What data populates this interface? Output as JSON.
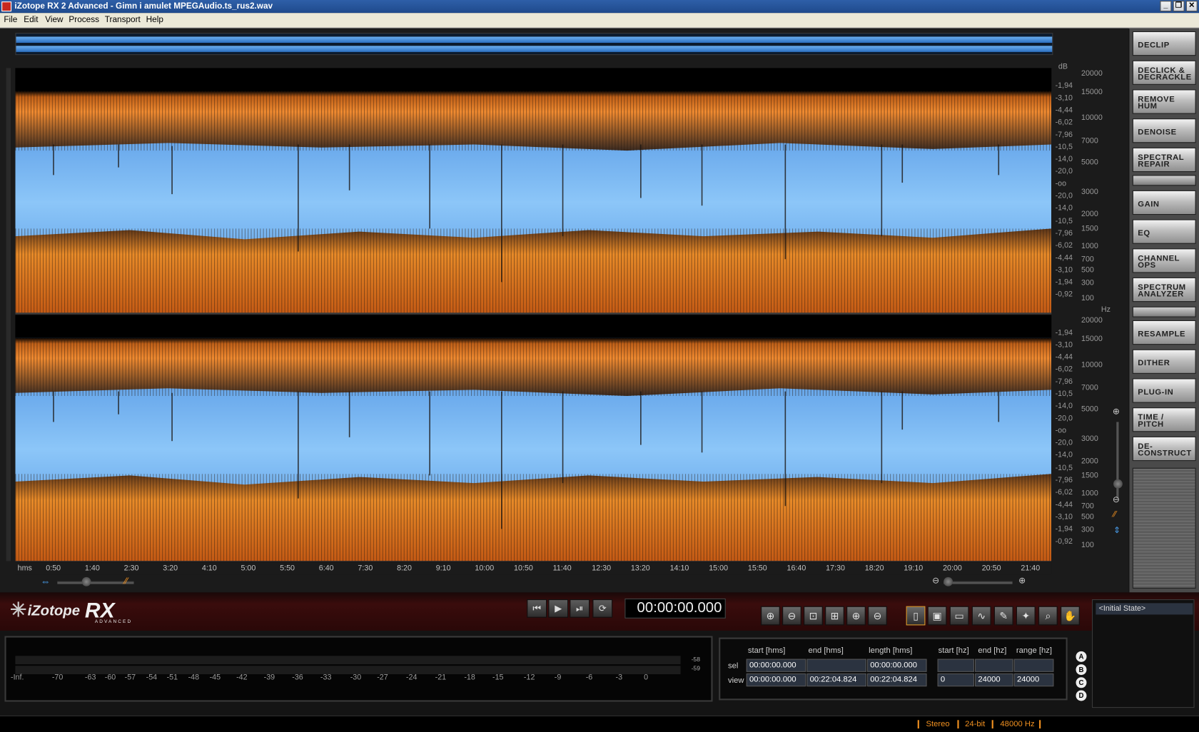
{
  "window": {
    "title": "iZotope RX 2 Advanced - Gimn i amulet MPEGAudio.ts_rus2.wav"
  },
  "menu": [
    "File",
    "Edit",
    "View",
    "Process",
    "Transport",
    "Help"
  ],
  "db_unit": "dB",
  "hz_unit": "Hz",
  "db_labels": [
    "-1,94",
    "-3,10",
    "-4,44",
    "-6,02",
    "-7,96",
    "-10,5",
    "-14,0",
    "-20,0",
    "-oo",
    "-20,0",
    "-14,0",
    "-10,5",
    "-7,96",
    "-6,02",
    "-4,44",
    "-3,10",
    "-1,94",
    "-0,92"
  ],
  "hz_labels": [
    "20000",
    "15000",
    "10000",
    "7000",
    "5000",
    "3000",
    "2000",
    "1500",
    "1000",
    "700",
    "500",
    "300",
    "100"
  ],
  "timeline": [
    "hms",
    "0:50",
    "1:40",
    "2:30",
    "3:20",
    "4:10",
    "5:00",
    "5:50",
    "6:40",
    "7:30",
    "8:20",
    "9:10",
    "10:00",
    "10:50",
    "11:40",
    "12:30",
    "13:20",
    "14:10",
    "15:00",
    "15:50",
    "16:40",
    "17:30",
    "18:20",
    "19:10",
    "20:00",
    "20:50",
    "21:40"
  ],
  "modules": [
    {
      "id": "declip",
      "line1": "DECLIP",
      "line2": ""
    },
    {
      "id": "declick",
      "line1": "DECLICK &",
      "line2": "DECRACKLE"
    },
    {
      "id": "remove-hum",
      "line1": "REMOVE",
      "line2": "HUM"
    },
    {
      "id": "denoise",
      "line1": "DENOISE",
      "line2": ""
    },
    {
      "id": "spectral-repair",
      "line1": "SPECTRAL",
      "line2": "REPAIR"
    },
    {
      "id": "gain",
      "line1": "GAIN",
      "line2": ""
    },
    {
      "id": "eq",
      "line1": "EQ",
      "line2": ""
    },
    {
      "id": "channel-ops",
      "line1": "CHANNEL",
      "line2": "OPS"
    },
    {
      "id": "spectrum-analyzer",
      "line1": "SPECTRUM",
      "line2": "ANALYZER"
    },
    {
      "id": "resample",
      "line1": "RESAMPLE",
      "line2": ""
    },
    {
      "id": "dither",
      "line1": "DITHER",
      "line2": ""
    },
    {
      "id": "plug-in",
      "line1": "PLUG-IN",
      "line2": ""
    },
    {
      "id": "time-pitch",
      "line1": "TIME /",
      "line2": "PITCH"
    },
    {
      "id": "deconstruct",
      "line1": "DE-",
      "line2": "CONSTRUCT"
    }
  ],
  "logo": {
    "brand": "iZotope",
    "product": "RX",
    "edition": "ADVANCED"
  },
  "transport": {
    "timecode": "00:00:00.000"
  },
  "meter": {
    "scale": [
      "-Inf.",
      "-70",
      "-63",
      "-60",
      "-57",
      "-54",
      "-51",
      "-48",
      "-45",
      "-42",
      "-39",
      "-36",
      "-33",
      "-30",
      "-27",
      "-24",
      "-21",
      "-18",
      "-15",
      "-12",
      "-9",
      "-6",
      "-3",
      "0"
    ],
    "peak_top": "-58",
    "peak_bottom": "-59"
  },
  "selection": {
    "headers": [
      "start [hms]",
      "end [hms]",
      "length [hms]",
      "start [hz]",
      "end [hz]",
      "range [hz]"
    ],
    "row_labels": [
      "sel",
      "view"
    ],
    "sel": [
      "00:00:00.000",
      "",
      "00:00:00.000",
      "",
      "",
      ""
    ],
    "view": [
      "00:00:00.000",
      "00:22:04.824",
      "00:22:04.824",
      "0",
      "24000",
      "24000"
    ]
  },
  "abcd": [
    "A",
    "B",
    "C",
    "D"
  ],
  "undo": {
    "initial_state": "<Initial State>"
  },
  "status": {
    "channels": "Stereo",
    "bit_depth": "24-bit",
    "sample_rate": "48000 Hz"
  },
  "colors": {
    "accent": "#f09020",
    "spectrum_fill": "#e07a20",
    "waveform_bg": "#6ab0f4"
  }
}
